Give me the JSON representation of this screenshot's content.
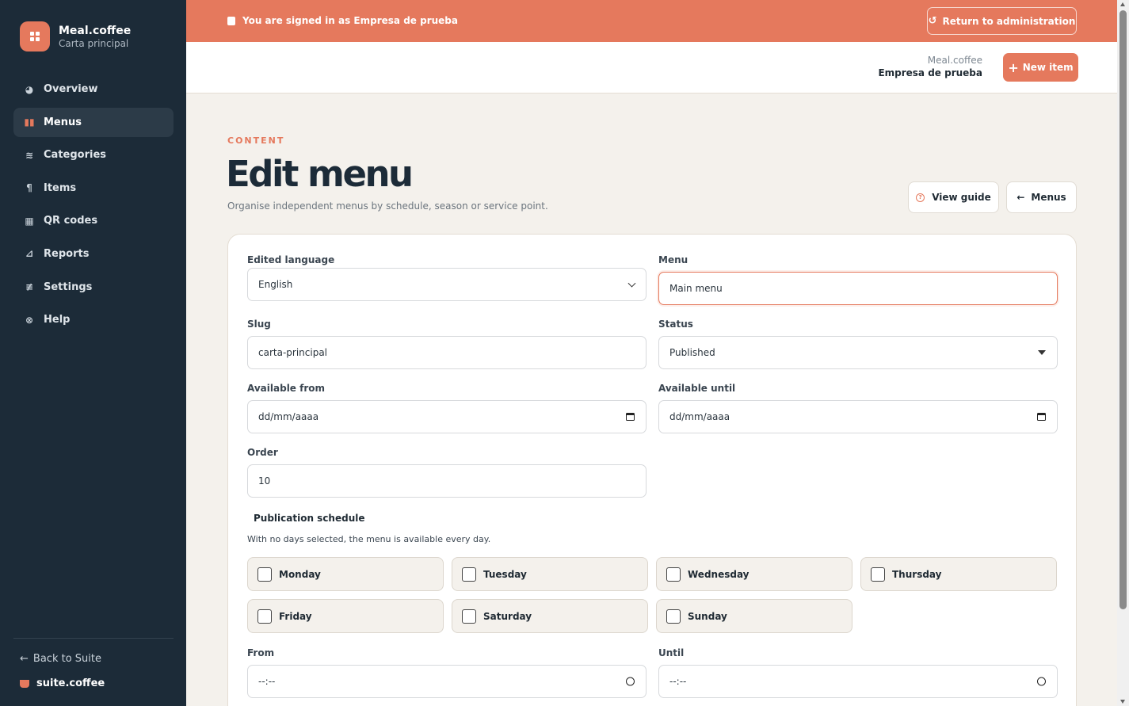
{
  "brand": {
    "title": "Meal.coffee",
    "subtitle": "Carta principal"
  },
  "sidebar": {
    "items": [
      {
        "label": "Overview",
        "icon": "chart-pie-icon"
      },
      {
        "label": "Menus",
        "icon": "book-open-icon",
        "active": true
      },
      {
        "label": "Categories",
        "icon": "layers-icon"
      },
      {
        "label": "Items",
        "icon": "utensils-icon"
      },
      {
        "label": "QR codes",
        "icon": "qr-code-icon"
      },
      {
        "label": "Reports",
        "icon": "line-chart-icon"
      },
      {
        "label": "Settings",
        "icon": "sliders-icon"
      },
      {
        "label": "Help",
        "icon": "life-ring-icon"
      }
    ],
    "back_label": "Back to Suite",
    "suite_label": "suite.coffee"
  },
  "banner": {
    "text": "You are signed in as Empresa de prueba",
    "return_label": "Return to administration"
  },
  "topbar": {
    "app_name": "Meal.coffee",
    "org_name": "Empresa de prueba",
    "new_item_label": "New item"
  },
  "page": {
    "eyebrow": "CONTENT",
    "title": "Edit menu",
    "description": "Organise independent menus by schedule, season or service point.",
    "guide_label": "View guide",
    "menus_label": "Menus"
  },
  "form": {
    "language": {
      "label": "Edited language",
      "value": "English"
    },
    "menu": {
      "label": "Menu",
      "value": "Main menu"
    },
    "slug": {
      "label": "Slug",
      "value": "carta-principal"
    },
    "status": {
      "label": "Status",
      "value": "Published"
    },
    "available_from": {
      "label": "Available from",
      "value": "dd/mm/aaaa"
    },
    "available_until": {
      "label": "Available until",
      "value": "dd/mm/aaaa"
    },
    "order": {
      "label": "Order",
      "value": "10"
    },
    "schedule": {
      "title": "Publication schedule",
      "description": "With no days selected, the menu is available every day.",
      "days": [
        "Monday",
        "Tuesday",
        "Wednesday",
        "Thursday",
        "Friday",
        "Saturday",
        "Sunday"
      ]
    },
    "from": {
      "label": "From",
      "value": "--:--"
    },
    "until": {
      "label": "Until",
      "value": "--:--"
    }
  },
  "colors": {
    "accent": "#e5795d",
    "sidebar": "#1c2b38",
    "background": "#f4f1ec"
  }
}
